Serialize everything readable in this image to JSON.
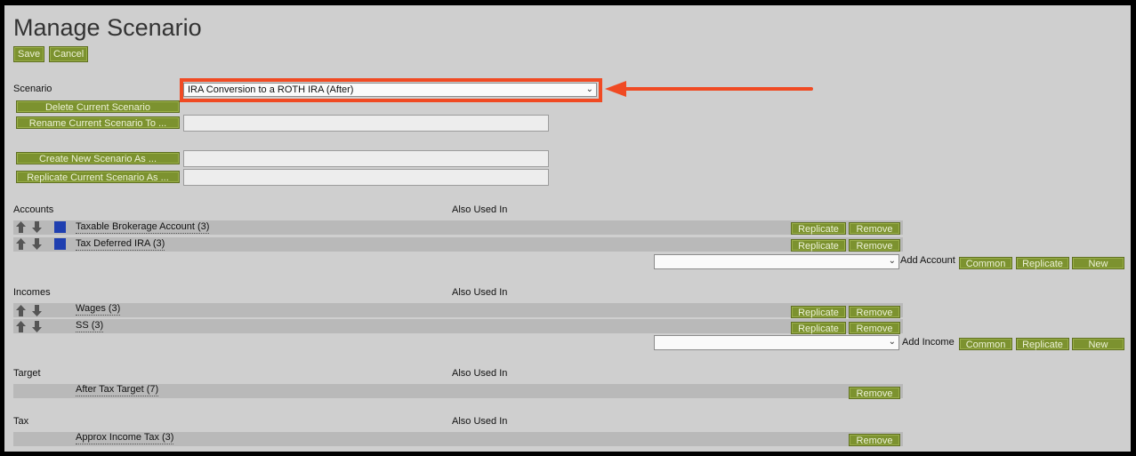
{
  "page": {
    "title": "Manage Scenario",
    "save_label": "Save",
    "cancel_label": "Cancel"
  },
  "scenario": {
    "label": "Scenario",
    "selected": "IRA Conversion to a ROTH IRA (After)",
    "delete_label": "Delete Current Scenario",
    "rename_label": "Rename Current Scenario To ...",
    "create_label": "Create New Scenario As ...",
    "replicate_label": "Replicate Current Scenario As ..."
  },
  "common": {
    "also_used_in": "Also Used In",
    "replicate": "Replicate",
    "remove": "Remove",
    "common": "Common",
    "new": "New"
  },
  "accounts": {
    "header": "Accounts",
    "items": [
      {
        "label": "Taxable Brokerage Account (3)"
      },
      {
        "label": "Tax Deferred IRA (3)"
      }
    ],
    "add_label": "Add Account",
    "add_selected": ""
  },
  "incomes": {
    "header": "Incomes",
    "items": [
      {
        "label": "Wages (3)"
      },
      {
        "label": "SS (3)"
      }
    ],
    "add_label": "Add Income",
    "add_selected": ""
  },
  "target": {
    "header": "Target",
    "items": [
      {
        "label": "After Tax Target (7)"
      }
    ]
  },
  "tax": {
    "header": "Tax",
    "items": [
      {
        "label": "Approx Income Tax (3)"
      }
    ]
  },
  "colors": {
    "button_green": "#7c922f",
    "highlight_red": "#f04a23",
    "account_blue": "#1f3fb0",
    "background": "#cfcfcf"
  },
  "icons": [
    "arrow-up-icon",
    "arrow-down-icon",
    "chevron-down-icon",
    "annotation-arrow-icon"
  ]
}
